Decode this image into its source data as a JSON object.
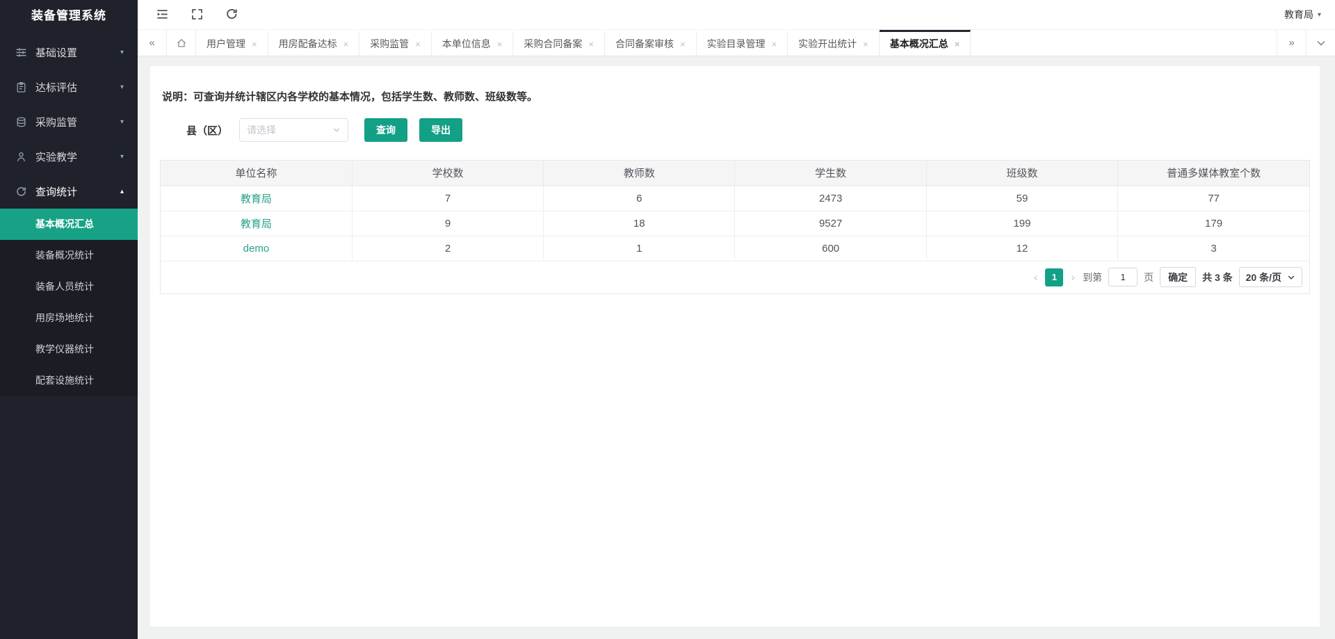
{
  "app": {
    "title": "装备管理系统",
    "user": "教育局"
  },
  "colors": {
    "accent": "#12a086",
    "accent_strong": "#17a286",
    "sidebar_bg": "#1f222a",
    "link": "#29a188"
  },
  "sidebar": {
    "menu": [
      {
        "label": "基础设置",
        "icon": "sliders-icon",
        "arrow": "▾",
        "open": false
      },
      {
        "label": "达标评估",
        "icon": "clipboard-icon",
        "arrow": "▾",
        "open": false
      },
      {
        "label": "采购监管",
        "icon": "stack-icon",
        "arrow": "▾",
        "open": false
      },
      {
        "label": "实验教学",
        "icon": "user-icon",
        "arrow": "▾",
        "open": false
      },
      {
        "label": "查询统计",
        "icon": "sync-icon",
        "arrow": "▴",
        "open": true
      }
    ],
    "submenu": [
      {
        "label": "基本概况汇总",
        "active": true
      },
      {
        "label": "装备概况统计",
        "active": false
      },
      {
        "label": "装备人员统计",
        "active": false
      },
      {
        "label": "用房场地统计",
        "active": false
      },
      {
        "label": "教学仪器统计",
        "active": false
      },
      {
        "label": "配套设施统计",
        "active": false
      }
    ]
  },
  "topbar": {
    "icons": [
      "menu-fold-icon",
      "fullscreen-icon",
      "refresh-icon"
    ],
    "user_caret": "▾"
  },
  "tabbar": {
    "back_label": "«",
    "forward_label": "»",
    "close_label": "×",
    "items": [
      {
        "label": "用户管理",
        "active": false
      },
      {
        "label": "用房配备达标",
        "active": false
      },
      {
        "label": "采购监管",
        "active": false
      },
      {
        "label": "本单位信息",
        "active": false
      },
      {
        "label": "采购合同备案",
        "active": false
      },
      {
        "label": "合同备案审核",
        "active": false
      },
      {
        "label": "实验目录管理",
        "active": false
      },
      {
        "label": "实验开出统计",
        "active": false
      },
      {
        "label": "基本概况汇总",
        "active": true
      }
    ]
  },
  "content": {
    "note": "说明：可查询并统计辖区内各学校的基本情况，包括学生数、教师数、班级数等。",
    "filter_label": "县（区）",
    "select_placeholder": "请选择",
    "query_label": "查询",
    "export_label": "导出"
  },
  "table": {
    "headers": [
      "单位名称",
      "学校数",
      "教师数",
      "学生数",
      "班级数",
      "普通多媒体教室个数"
    ],
    "rows": [
      [
        "教育局",
        "7",
        "6",
        "2473",
        "59",
        "77"
      ],
      [
        "教育局",
        "9",
        "18",
        "9527",
        "199",
        "179"
      ],
      [
        "demo",
        "2",
        "1",
        "600",
        "12",
        "3"
      ]
    ]
  },
  "pagination": {
    "prev": "‹",
    "next": "›",
    "page": "1",
    "goto_prefix": "到第",
    "goto_value": "1",
    "goto_suffix": "页",
    "confirm_label": "确定",
    "total": "共 3 条",
    "page_size": "20 条/页"
  }
}
